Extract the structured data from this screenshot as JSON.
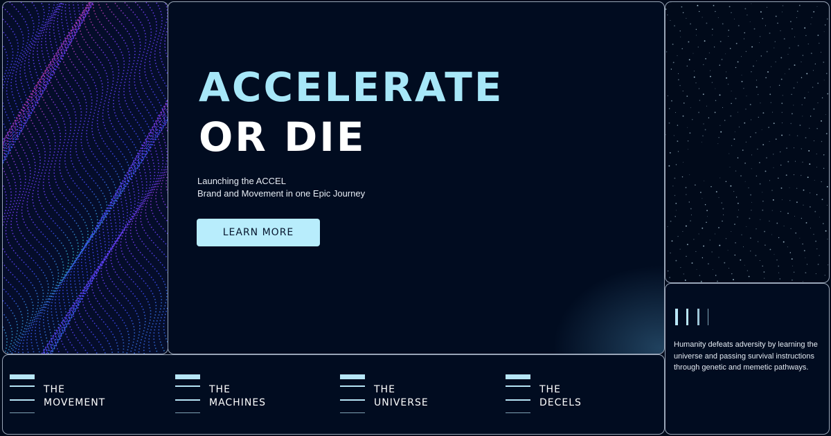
{
  "hero": {
    "title_line_1": "ACCELERATE",
    "title_line_2": "OR DIE",
    "subtitle_line_1": "Launching the ACCEL",
    "subtitle_line_2": "Brand and Movement in one Epic Journey",
    "cta_label": "LEARN MORE"
  },
  "nav": {
    "items": [
      {
        "line1": "THE",
        "line2": "MOVEMENT"
      },
      {
        "line1": "THE",
        "line2": "MACHINES"
      },
      {
        "line1": "THE",
        "line2": "UNIVERSE"
      },
      {
        "line1": "THE",
        "line2": "DECELS"
      }
    ]
  },
  "info": {
    "text": "Humanity defeats adversity by learning the universe and passing survival instructions through genetic and memetic pathways."
  },
  "colors": {
    "background": "#010c20",
    "accent": "#a7e7f8",
    "button": "#b8edfc",
    "panel_border": "#9aa6b8"
  },
  "icons": {
    "nav_icon": "stacked-lines-icon",
    "info_icon": "vertical-bars-icon"
  }
}
